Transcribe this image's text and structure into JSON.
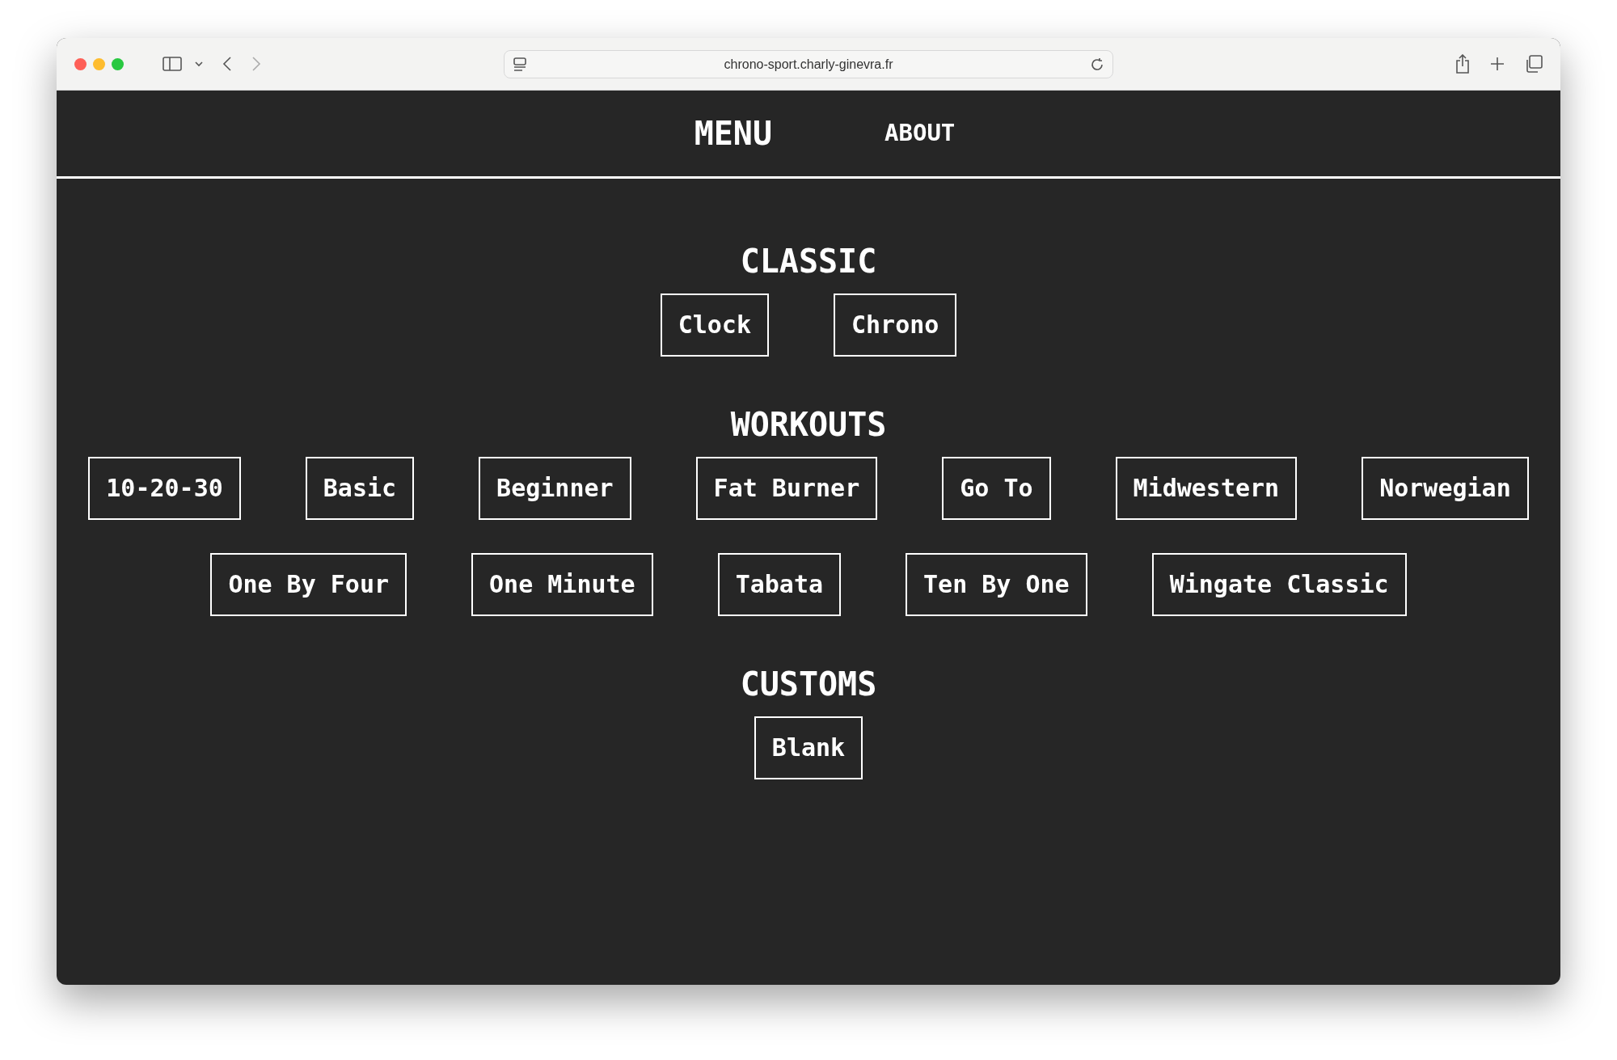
{
  "browser": {
    "url": "chrono-sport.charly-ginevra.fr"
  },
  "nav": [
    {
      "label": "MENU",
      "selected": true
    },
    {
      "label": "ABOUT",
      "selected": false
    }
  ],
  "sections": [
    {
      "title": "CLASSIC",
      "buttons": [
        "Clock",
        "Chrono"
      ]
    },
    {
      "title": "WORKOUTS",
      "buttons": [
        "10-20-30",
        "Basic",
        "Beginner",
        "Fat Burner",
        "Go To",
        "Midwestern",
        "Norwegian",
        "One By Four",
        "One Minute",
        "Tabata",
        "Ten By One",
        "Wingate Classic"
      ]
    },
    {
      "title": "CUSTOMS",
      "buttons": [
        "Blank"
      ]
    }
  ]
}
